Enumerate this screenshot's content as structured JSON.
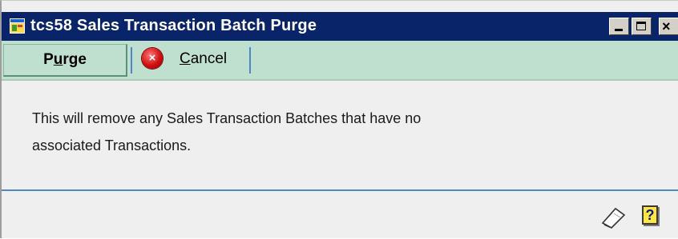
{
  "window": {
    "title": "tcs58 Sales Transaction Batch Purge",
    "controls": {
      "minimize": "minimize",
      "maximize": "maximize",
      "close": "×"
    }
  },
  "toolbar": {
    "purge_label_prefix": "P",
    "purge_label_underlined": "u",
    "purge_label_suffix": "rge",
    "cancel_label_underlined": "C",
    "cancel_label_suffix": "ancel",
    "cancel_icon_glyph": "×"
  },
  "message": {
    "line1": "This will remove any Sales Transaction Batches that have no",
    "line2": "associated Transactions."
  },
  "statusbar": {
    "note_icon": "note-icon",
    "help_icon_glyph": "?"
  },
  "colors": {
    "titlebar": "#0a246a",
    "toolbar": "#bfe0cf",
    "separator": "#4f86c6",
    "window_bg": "#efefef"
  }
}
